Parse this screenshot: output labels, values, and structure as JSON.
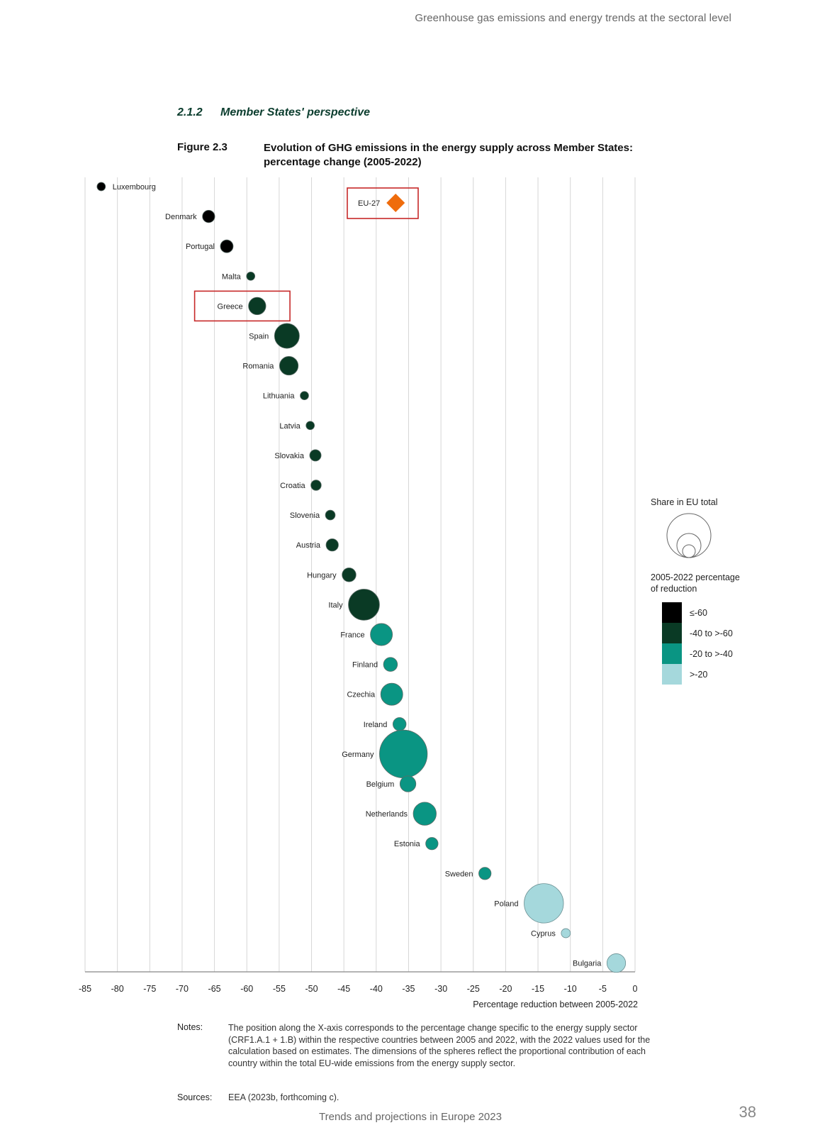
{
  "header": {
    "running_title": "Greenhouse gas emissions and energy trends at the sectoral level"
  },
  "section": {
    "number": "2.1.2",
    "title": "Member States' perspective"
  },
  "figure": {
    "label": "Figure 2.3",
    "title": "Evolution of GHG emissions in the energy supply across Member States: percentage change (2005-2022)"
  },
  "chart_data": {
    "type": "scatter",
    "title": "Evolution of GHG emissions in the energy supply across Member States: percentage change (2005-2022)",
    "xlabel": "Percentage reduction between 2005-2022",
    "ylabel": "",
    "xlim": [
      -85,
      0
    ],
    "xticks": [
      -85,
      -80,
      -75,
      -70,
      -65,
      -60,
      -55,
      -50,
      -45,
      -40,
      -35,
      -30,
      -25,
      -20,
      -15,
      -10,
      -5,
      0
    ],
    "grid": true,
    "size_encoding": "Share in EU total (relative bubble size)",
    "color_legend": {
      "title": "2005-2022 percentage of reduction",
      "size_title": "Share in EU total",
      "placement": "right",
      "classes": [
        {
          "label": "≤-60",
          "color": "#000000"
        },
        {
          "label": "-40 to >-60",
          "color": "#0a3a25"
        },
        {
          "label": "-20 to >-40",
          "color": "#0a9583"
        },
        {
          "label": ">-20",
          "color": "#a5d8dc"
        }
      ]
    },
    "series": [
      {
        "name": "Luxembourg",
        "x": -82.5,
        "size": 0.3,
        "class": 0
      },
      {
        "name": "Denmark",
        "x": -65.9,
        "size": 1.0,
        "class": 0
      },
      {
        "name": "Portugal",
        "x": -63.1,
        "size": 1.1,
        "class": 0
      },
      {
        "name": "Malta",
        "x": -59.4,
        "size": 0.3,
        "class": 1
      },
      {
        "name": "Greece",
        "x": -58.4,
        "size": 2.5,
        "class": 1,
        "highlight": true
      },
      {
        "name": "Spain",
        "x": -53.8,
        "size": 6.0,
        "class": 1
      },
      {
        "name": "Romania",
        "x": -53.5,
        "size": 3.0,
        "class": 1
      },
      {
        "name": "Lithuania",
        "x": -51.1,
        "size": 0.3,
        "class": 1
      },
      {
        "name": "Latvia",
        "x": -50.2,
        "size": 0.3,
        "class": 1
      },
      {
        "name": "Slovakia",
        "x": -49.4,
        "size": 0.8,
        "class": 1
      },
      {
        "name": "Croatia",
        "x": -49.3,
        "size": 0.6,
        "class": 1
      },
      {
        "name": "Slovenia",
        "x": -47.1,
        "size": 0.5,
        "class": 1
      },
      {
        "name": "Austria",
        "x": -46.8,
        "size": 1.0,
        "class": 1
      },
      {
        "name": "Hungary",
        "x": -44.2,
        "size": 1.4,
        "class": 1
      },
      {
        "name": "Italy",
        "x": -41.9,
        "size": 10.0,
        "class": 1
      },
      {
        "name": "France",
        "x": -39.2,
        "size": 4.5,
        "class": 2
      },
      {
        "name": "Finland",
        "x": -37.8,
        "size": 1.4,
        "class": 2
      },
      {
        "name": "Czechia",
        "x": -37.6,
        "size": 4.5,
        "class": 2
      },
      {
        "name": "Ireland",
        "x": -36.4,
        "size": 1.2,
        "class": 2
      },
      {
        "name": "Germany",
        "x": -35.8,
        "size": 26.0,
        "class": 2
      },
      {
        "name": "Belgium",
        "x": -35.1,
        "size": 2.0,
        "class": 2
      },
      {
        "name": "Netherlands",
        "x": -32.5,
        "size": 5.0,
        "class": 2
      },
      {
        "name": "Estonia",
        "x": -31.4,
        "size": 1.0,
        "class": 2
      },
      {
        "name": "Sweden",
        "x": -23.2,
        "size": 1.0,
        "class": 2
      },
      {
        "name": "Poland",
        "x": -14.1,
        "size": 17.0,
        "class": 3
      },
      {
        "name": "Cyprus",
        "x": -10.7,
        "size": 0.4,
        "class": 3
      },
      {
        "name": "Bulgaria",
        "x": -2.9,
        "size": 3.0,
        "class": 3
      }
    ],
    "aggregate": {
      "name": "EU-27",
      "x": -37.0,
      "marker": "diamond",
      "color": "#ef6c0c",
      "highlight": true
    },
    "highlight_color": "#c62828"
  },
  "notes": {
    "label": "Notes:",
    "text": "The position along the X-axis corresponds to the percentage change specific to the energy supply sector (CRF1.A.1 + 1.B) within the respective countries between 2005 and 2022, with the 2022 values used for the calculation based on estimates. The dimensions of the spheres reflect the proportional contribution of each country within the total EU-wide emissions from the energy supply sector."
  },
  "sources": {
    "label": "Sources:",
    "text": "EEA (2023b, forthcoming c)."
  },
  "footer": {
    "publication": "Trends and projections in Europe 2023",
    "page": "38"
  }
}
